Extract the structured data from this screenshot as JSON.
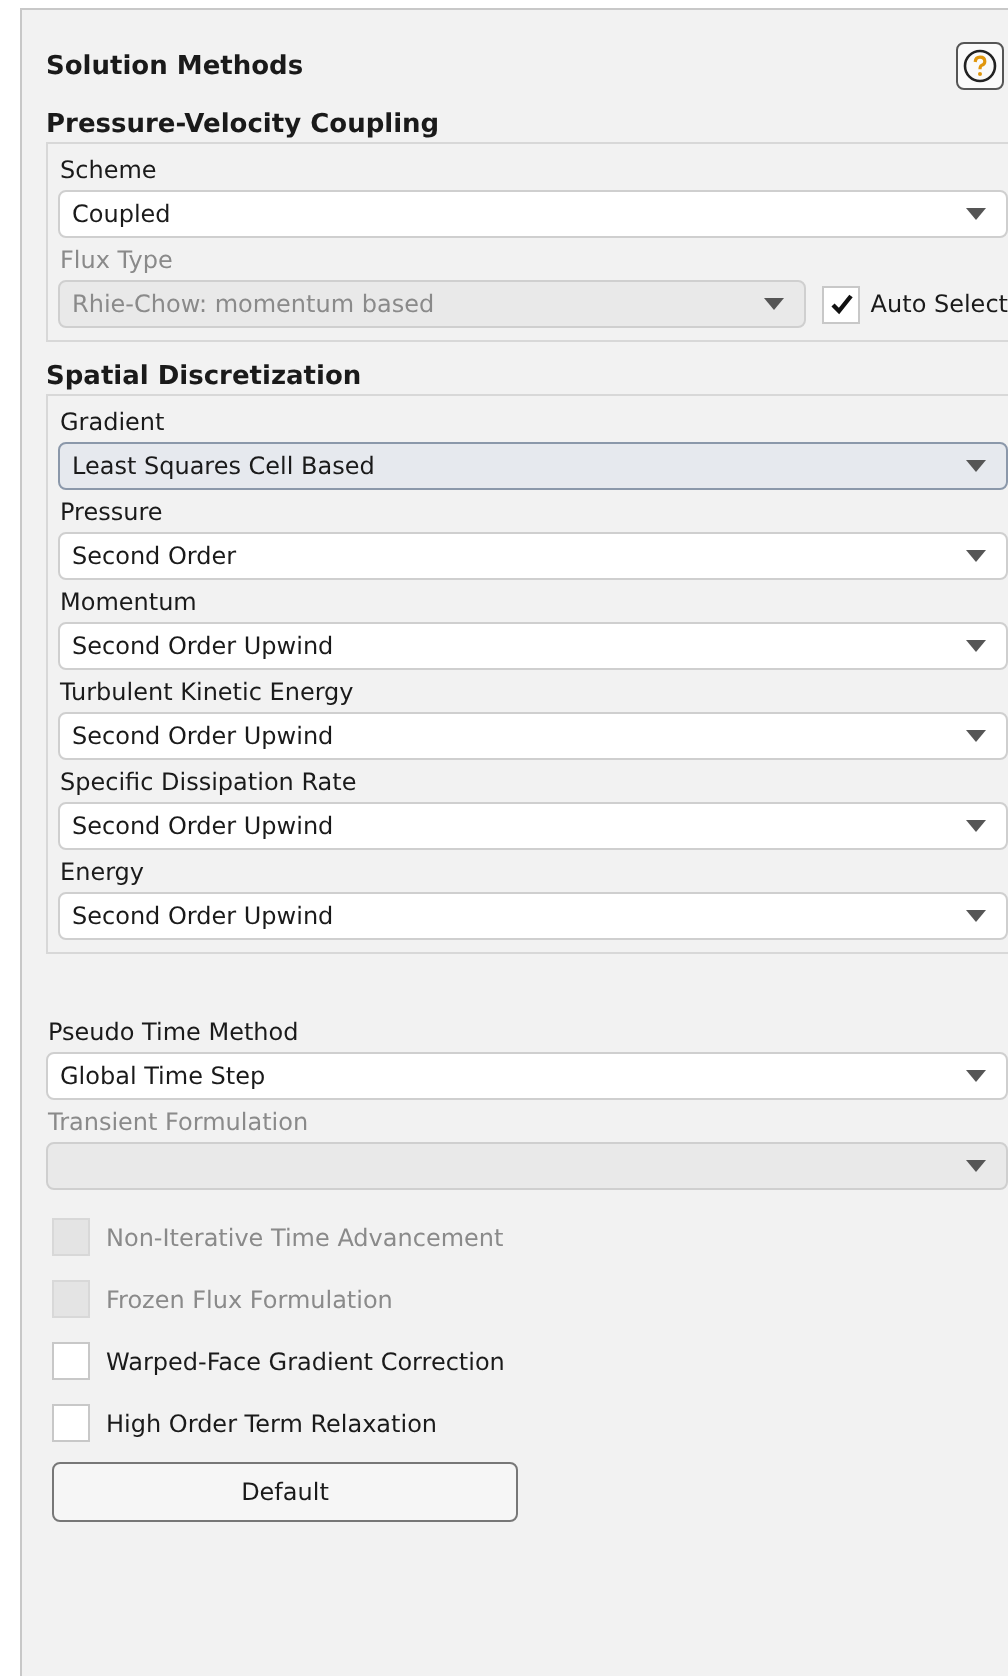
{
  "title": "Solution Methods",
  "groups": [
    {
      "title": "Pressure-Velocity Coupling",
      "fields": [
        {
          "label": "Scheme",
          "value": "Coupled",
          "disabled": false,
          "highlighted": false
        },
        {
          "label": "Flux Type",
          "value": "Rhie-Chow: momentum based",
          "disabled": true,
          "highlighted": false,
          "auto_select": {
            "label": "Auto Select",
            "checked": true
          }
        }
      ]
    },
    {
      "title": "Spatial Discretization",
      "fields": [
        {
          "label": "Gradient",
          "value": "Least Squares Cell Based",
          "disabled": false,
          "highlighted": true
        },
        {
          "label": "Pressure",
          "value": "Second Order",
          "disabled": false,
          "highlighted": false
        },
        {
          "label": "Momentum",
          "value": "Second Order Upwind",
          "disabled": false,
          "highlighted": false
        },
        {
          "label": "Turbulent Kinetic Energy",
          "value": "Second Order Upwind",
          "disabled": false,
          "highlighted": false
        },
        {
          "label": "Specific Dissipation Rate",
          "value": "Second Order Upwind",
          "disabled": false,
          "highlighted": false
        },
        {
          "label": "Energy",
          "value": "Second Order Upwind",
          "disabled": false,
          "highlighted": false
        }
      ]
    }
  ],
  "fields": [
    {
      "label": "Pseudo Time Method",
      "value": "Global Time Step",
      "disabled": false,
      "highlighted": false
    },
    {
      "label": "Transient Formulation",
      "disabled": true,
      "highlighted": false
    }
  ],
  "options": [
    {
      "label": "Non-Iterative Time Advancement",
      "checked": false,
      "disabled": true
    },
    {
      "label": "Frozen Flux Formulation",
      "checked": false,
      "disabled": true
    },
    {
      "label": "Warped-Face Gradient Correction",
      "checked": false,
      "disabled": false
    },
    {
      "label": "High Order Term Relaxation",
      "checked": false,
      "disabled": false
    }
  ],
  "buttons": [
    "Default"
  ]
}
